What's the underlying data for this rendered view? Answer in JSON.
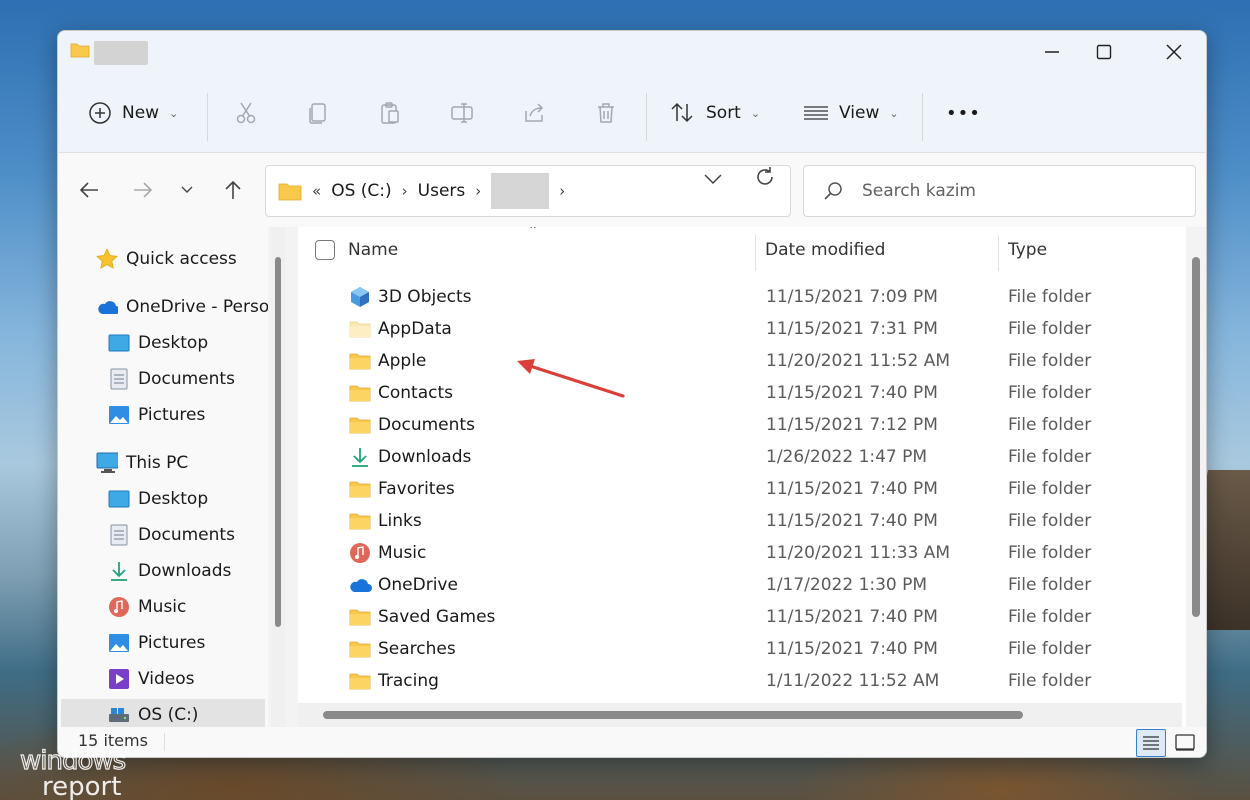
{
  "window": {
    "title_icon": "folder-icon"
  },
  "commandbar": {
    "new_label": "New",
    "sort_label": "Sort",
    "view_label": "View",
    "more_label": "•••"
  },
  "address": {
    "overflow": "«",
    "crumbs": [
      "OS (C:)",
      "Users"
    ]
  },
  "search": {
    "placeholder": "Search kazim"
  },
  "sidebar": {
    "items": [
      {
        "label": "Quick access",
        "icon": "star-icon"
      },
      {
        "label": "OneDrive - Persor",
        "icon": "cloud-icon"
      },
      {
        "label": "Desktop",
        "icon": "desktop-icon"
      },
      {
        "label": "Documents",
        "icon": "documents-icon"
      },
      {
        "label": "Pictures",
        "icon": "pictures-icon"
      },
      {
        "label": "This PC",
        "icon": "monitor-icon"
      },
      {
        "label": "Desktop",
        "icon": "desktop-icon"
      },
      {
        "label": "Documents",
        "icon": "documents-icon"
      },
      {
        "label": "Downloads",
        "icon": "download-icon"
      },
      {
        "label": "Music",
        "icon": "music-icon"
      },
      {
        "label": "Pictures",
        "icon": "pictures-icon"
      },
      {
        "label": "Videos",
        "icon": "videos-icon"
      },
      {
        "label": "OS (C:)",
        "icon": "drive-icon"
      }
    ]
  },
  "columns": {
    "name": "Name",
    "date": "Date modified",
    "type": "Type"
  },
  "rows": [
    {
      "name": "3D Objects",
      "date": "11/15/2021 7:09 PM",
      "type": "File folder",
      "icon": "3d-objects-icon"
    },
    {
      "name": "AppData",
      "date": "11/15/2021 7:31 PM",
      "type": "File folder",
      "icon": "hidden-folder-icon"
    },
    {
      "name": "Apple",
      "date": "11/20/2021 11:52 AM",
      "type": "File folder",
      "icon": "folder-icon"
    },
    {
      "name": "Contacts",
      "date": "11/15/2021 7:40 PM",
      "type": "File folder",
      "icon": "folder-icon"
    },
    {
      "name": "Documents",
      "date": "11/15/2021 7:12 PM",
      "type": "File folder",
      "icon": "folder-icon"
    },
    {
      "name": "Downloads",
      "date": "1/26/2022 1:47 PM",
      "type": "File folder",
      "icon": "download-icon"
    },
    {
      "name": "Favorites",
      "date": "11/15/2021 7:40 PM",
      "type": "File folder",
      "icon": "folder-icon"
    },
    {
      "name": "Links",
      "date": "11/15/2021 7:40 PM",
      "type": "File folder",
      "icon": "folder-icon"
    },
    {
      "name": "Music",
      "date": "11/20/2021 11:33 AM",
      "type": "File folder",
      "icon": "music-icon"
    },
    {
      "name": "OneDrive",
      "date": "1/17/2022 1:30 PM",
      "type": "File folder",
      "icon": "cloud-icon"
    },
    {
      "name": "Saved Games",
      "date": "11/15/2021 7:40 PM",
      "type": "File folder",
      "icon": "folder-icon"
    },
    {
      "name": "Searches",
      "date": "11/15/2021 7:40 PM",
      "type": "File folder",
      "icon": "folder-icon"
    },
    {
      "name": "Tracing",
      "date": "1/11/2022 11:52 AM",
      "type": "File folder",
      "icon": "folder-icon"
    }
  ],
  "status": {
    "count": "15 items"
  },
  "watermark": {
    "line1": "windows",
    "line2": "report"
  },
  "colors": {
    "folder": "#f8c94a",
    "accent": "#3a7bd5",
    "arrow": "#d9403a"
  }
}
